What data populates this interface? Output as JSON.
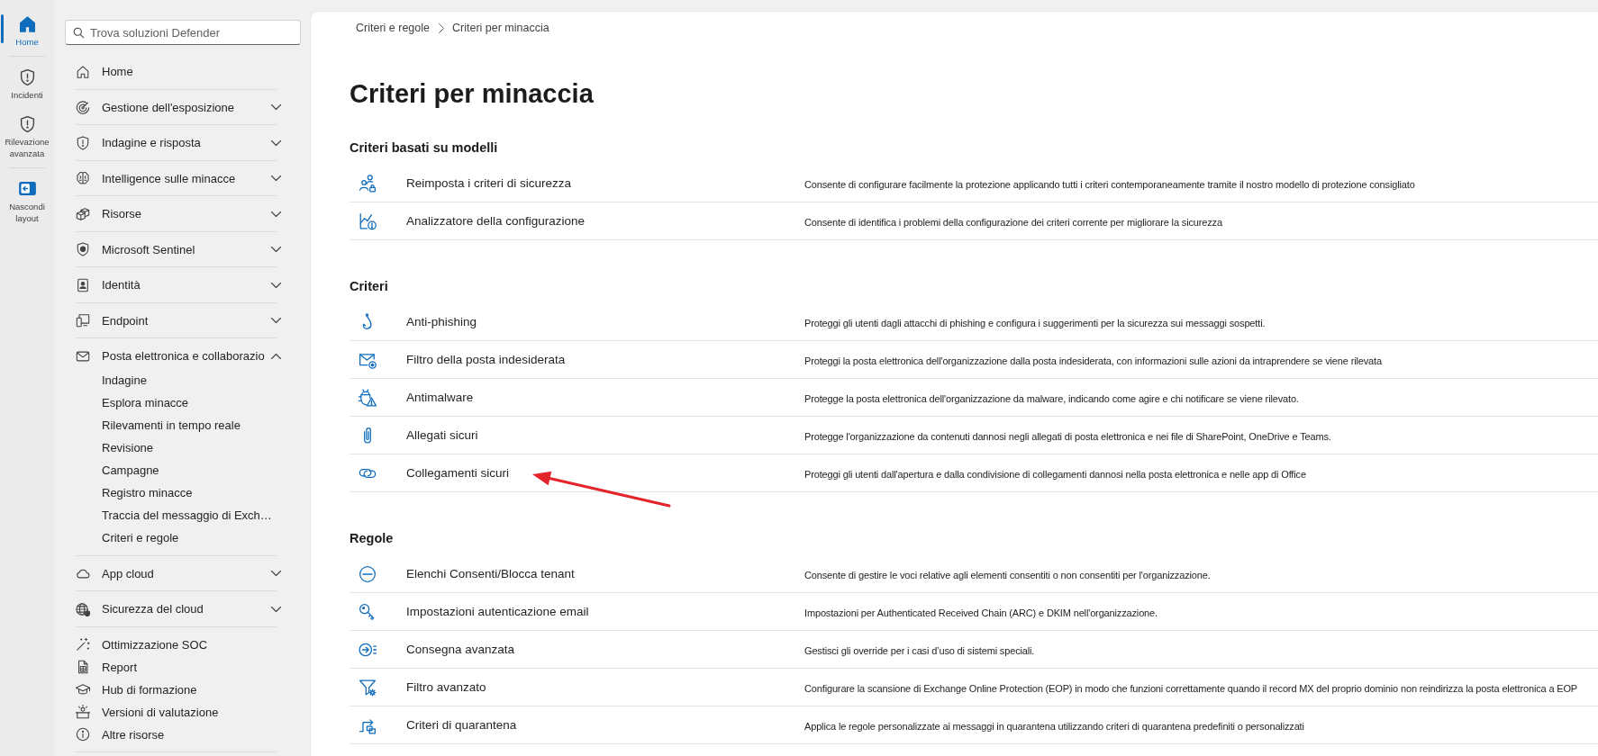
{
  "rail": {
    "items": [
      {
        "label": "Home",
        "selected": true
      },
      {
        "label": "Incidenti",
        "selected": false
      },
      {
        "label": "Rilevazione avanzata",
        "selected": false
      }
    ],
    "toggle": {
      "label": "Nascondi layout"
    }
  },
  "sidebar": {
    "search": {
      "placeholder": "Trova soluzioni Defender"
    },
    "sections": [
      {
        "items": [
          {
            "label": "Home",
            "kind": "link"
          }
        ]
      },
      {
        "items": [
          {
            "label": "Gestione dell'esposizione",
            "kind": "group",
            "expanded": false
          }
        ]
      },
      {
        "items": [
          {
            "label": "Indagine e risposta",
            "kind": "group",
            "expanded": false
          }
        ]
      },
      {
        "items": [
          {
            "label": "Intelligence sulle minacce",
            "kind": "group",
            "expanded": false
          }
        ]
      },
      {
        "items": [
          {
            "label": "Risorse",
            "kind": "group",
            "expanded": false
          }
        ]
      },
      {
        "items": [
          {
            "label": "Microsoft Sentinel",
            "kind": "group",
            "expanded": false
          }
        ]
      },
      {
        "items": [
          {
            "label": "Identità",
            "kind": "group",
            "expanded": false
          }
        ]
      },
      {
        "items": [
          {
            "label": "Endpoint",
            "kind": "group",
            "expanded": false
          }
        ]
      },
      {
        "items": [
          {
            "label": "Posta elettronica e collaborazio",
            "kind": "group",
            "expanded": true,
            "children": [
              {
                "label": "Indagine"
              },
              {
                "label": "Esplora minacce"
              },
              {
                "label": "Rilevamenti in tempo reale"
              },
              {
                "label": "Revisione"
              },
              {
                "label": "Campagne"
              },
              {
                "label": "Registro minacce"
              },
              {
                "label": "Traccia del messaggio di Exch…"
              },
              {
                "label": "Criteri e regole"
              }
            ]
          }
        ]
      },
      {
        "items": [
          {
            "label": "App cloud",
            "kind": "group",
            "expanded": false
          }
        ]
      },
      {
        "items": [
          {
            "label": "Sicurezza del cloud",
            "kind": "group",
            "expanded": false
          }
        ]
      },
      {
        "items": [
          {
            "label": "Ottimizzazione SOC",
            "kind": "link"
          },
          {
            "label": "Report",
            "kind": "link"
          },
          {
            "label": "Hub di formazione",
            "kind": "link"
          },
          {
            "label": "Versioni di valutazione",
            "kind": "link"
          },
          {
            "label": "Altre risorse",
            "kind": "link"
          }
        ]
      }
    ]
  },
  "breadcrumb": [
    "Criteri e regole",
    "Criteri per minaccia"
  ],
  "title": "Criteri per minaccia",
  "sections": [
    {
      "heading": "Criteri basati su modelli",
      "rows": [
        {
          "name": "Reimposta i criteri di sicurezza",
          "description": "Consente di configurare facilmente la protezione applicando tutti i criteri contemporaneamente tramite il nostro modello di protezione consigliato",
          "annotated": false
        },
        {
          "name": "Analizzatore della configurazione",
          "description": "Consente di identifica i problemi della configurazione dei criteri corrente per migliorare la sicurezza",
          "annotated": false
        }
      ]
    },
    {
      "heading": "Criteri",
      "rows": [
        {
          "name": "Anti-phishing",
          "description": "Proteggi gli utenti dagli attacchi di phishing e configura i suggerimenti per la sicurezza sui messaggi sospetti.",
          "annotated": false
        },
        {
          "name": "Filtro della posta indesiderata",
          "description": "Proteggi la posta elettronica dell'organizzazione dalla posta indesiderata, con informazioni sulle azioni da intraprendere se viene rilevata",
          "annotated": false
        },
        {
          "name": "Antimalware",
          "description": "Protegge la posta elettronica dell'organizzazione da malware, indicando come agire e chi notificare se viene rilevato.",
          "annotated": false
        },
        {
          "name": "Allegati sicuri",
          "description": "Protegge l'organizzazione da contenuti dannosi negli allegati di posta elettronica e nei file di SharePoint, OneDrive e Teams.",
          "annotated": false
        },
        {
          "name": "Collegamenti sicuri",
          "description": "Proteggi gli utenti dall'apertura e dalla condivisione di collegamenti dannosi nella posta elettronica e nelle app di Office",
          "annotated": true
        }
      ]
    },
    {
      "heading": "Regole",
      "rows": [
        {
          "name": "Elenchi Consenti/Blocca tenant",
          "description": "Consente di gestire le voci relative agli elementi consentiti o non consentiti per l'organizzazione.",
          "annotated": false
        },
        {
          "name": "Impostazioni autenticazione email",
          "description": "Impostazioni per Authenticated Received Chain (ARC) e DKIM nell'organizzazione.",
          "annotated": false
        },
        {
          "name": "Consegna avanzata",
          "description": "Gestisci gli override per i casi d’uso di sistemi speciali.",
          "annotated": false
        },
        {
          "name": "Filtro avanzato",
          "description": "Configurare la scansione di Exchange Online Protection (EOP) in modo che funzioni correttamente quando il record MX del proprio dominio non reindirizza la posta elettronica a EOP",
          "annotated": false
        },
        {
          "name": "Criteri di quarantena",
          "description": "Applica le regole personalizzate ai messaggi in quarantena utilizzando criteri di quarantena predefiniti o personalizzati",
          "annotated": false
        }
      ]
    }
  ]
}
